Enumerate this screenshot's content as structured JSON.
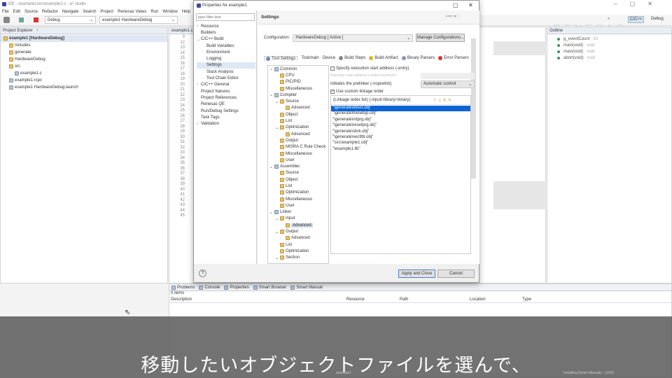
{
  "window": {
    "title": "IDE - example1/src/example1.c - e² studio",
    "menu": [
      "File",
      "Edit",
      "Source",
      "Refactor",
      "Navigate",
      "Search",
      "Project",
      "Renesas Views",
      "Run",
      "Window",
      "Help"
    ]
  },
  "toolbar": {
    "build_config": "Debug",
    "launch_config": "example1 HardwareDebug",
    "perspectives": [
      "C/C++",
      "Debug"
    ]
  },
  "project_explorer": {
    "title": "Project Explorer",
    "items": [
      {
        "label": "example1 [HardwareDebug]",
        "level": 0,
        "bold": true
      },
      {
        "label": "Includes",
        "level": 1
      },
      {
        "label": "generate",
        "level": 1
      },
      {
        "label": "HardwareDebug",
        "level": 1
      },
      {
        "label": "src",
        "level": 1
      },
      {
        "label": "example1.c",
        "level": 2
      },
      {
        "label": "example1.rcpc",
        "level": 1
      },
      {
        "label": "example1 HardwareDebug.launch",
        "level": 1
      }
    ]
  },
  "editor": {
    "tab": "example1.c",
    "line_numbers": [
      "3",
      "12",
      "13",
      "14",
      "15",
      "16",
      "17",
      "18",
      "19",
      "20",
      "21",
      "22",
      "23",
      "24",
      "25",
      "26",
      "27",
      "28",
      "29",
      "30",
      "31",
      "32",
      "33",
      "34",
      "35",
      "36",
      "37",
      "38",
      "39",
      "40",
      "41",
      "42",
      "43",
      "44",
      "45"
    ]
  },
  "outline": {
    "title": "Outline",
    "items": [
      {
        "name": "g_eventCount",
        "type": ": int"
      },
      {
        "name": "main(void)",
        "type": ": void"
      },
      {
        "name": "main(void)",
        "type": ": void"
      },
      {
        "name": "abort(void)",
        "type": ": void"
      }
    ]
  },
  "dialog": {
    "title": "Properties for example1",
    "filter_placeholder": "type filter text",
    "nav": [
      {
        "label": "Resource",
        "level": 0,
        "arrow": ">"
      },
      {
        "label": "Builders",
        "level": 0
      },
      {
        "label": "C/C++ Build",
        "level": 0,
        "arrow": "v"
      },
      {
        "label": "Build Variables",
        "level": 1
      },
      {
        "label": "Environment",
        "level": 1
      },
      {
        "label": "Logging",
        "level": 1
      },
      {
        "label": "Settings",
        "level": 1,
        "selected": true
      },
      {
        "label": "Stack Analysis",
        "level": 1
      },
      {
        "label": "Tool Chain Editor",
        "level": 1
      },
      {
        "label": "C/C++ General",
        "level": 0,
        "arrow": ">"
      },
      {
        "label": "Project Natures",
        "level": 0
      },
      {
        "label": "Project References",
        "level": 0
      },
      {
        "label": "Renesas QE",
        "level": 0
      },
      {
        "label": "Run/Debug Settings",
        "level": 0
      },
      {
        "label": "Task Tags",
        "level": 0
      },
      {
        "label": "Validation",
        "level": 0,
        "arrow": ">"
      }
    ],
    "page_title": "Settings",
    "configuration_label": "Configuration:",
    "configuration_value": "HardwareDebug  [ Active ]",
    "manage_button": "Manage Configurations...",
    "tabs": [
      "Tool Settings",
      "Toolchain",
      "Device",
      "Build Steps",
      "Build Artifact",
      "Binary Parsers",
      "Error Parsers"
    ],
    "tool_tree": [
      {
        "label": "Common",
        "level": 0,
        "arrow": "v",
        "tool": true
      },
      {
        "label": "CPU",
        "level": 1
      },
      {
        "label": "PIC/PID",
        "level": 1
      },
      {
        "label": "Miscellaneous",
        "level": 1
      },
      {
        "label": "Compiler",
        "level": 0,
        "arrow": "v",
        "tool": true
      },
      {
        "label": "Source",
        "level": 1,
        "arrow": "v"
      },
      {
        "label": "Advanced",
        "level": 2
      },
      {
        "label": "Object",
        "level": 1
      },
      {
        "label": "List",
        "level": 1
      },
      {
        "label": "Optimization",
        "level": 1,
        "arrow": "v"
      },
      {
        "label": "Advanced",
        "level": 2
      },
      {
        "label": "Output",
        "level": 1
      },
      {
        "label": "MISRA C Rule Check",
        "level": 1
      },
      {
        "label": "Miscellaneous",
        "level": 1
      },
      {
        "label": "User",
        "level": 1
      },
      {
        "label": "Assembler",
        "level": 0,
        "arrow": "v",
        "tool": true
      },
      {
        "label": "Source",
        "level": 1
      },
      {
        "label": "Object",
        "level": 1
      },
      {
        "label": "List",
        "level": 1
      },
      {
        "label": "Optimization",
        "level": 1
      },
      {
        "label": "Miscellaneous",
        "level": 1
      },
      {
        "label": "User",
        "level": 1
      },
      {
        "label": "Linker",
        "level": 0,
        "arrow": "v",
        "tool": true
      },
      {
        "label": "Input",
        "level": 1,
        "arrow": "v"
      },
      {
        "label": "Advanced",
        "level": 2,
        "selected": true
      },
      {
        "label": "Output",
        "level": 1,
        "arrow": "v"
      },
      {
        "label": "Advanced",
        "level": 2
      },
      {
        "label": "List",
        "level": 1
      },
      {
        "label": "Optimization",
        "level": 1
      },
      {
        "label": "Section",
        "level": 1,
        "arrow": "v"
      }
    ],
    "entry_checkbox": {
      "label": "Specify execution start address (-entry)",
      "checked": false
    },
    "entry_field_label": "Execution start address (-entry=<symbol>)",
    "prelinker_label": "Initiates the prelinker (-noprelink)",
    "prelinker_value": "Automatic control",
    "linkage_checkbox": {
      "label": "Use custom linkage order",
      "checked": true
    },
    "linkage_header": "(Linkage order list) (-input/-library/-binary)",
    "linkage_items": [
      "\"\\generate\\dbsct.obj\"",
      "\"\\generate\\hwsetup.obj\"",
      "\"\\generate\\intprg.obj\"",
      "\"\\generate\\resetprg.obj\"",
      "\"\\generate\\sbrk.obj\"",
      "\"\\generate\\vecttbl.obj\"",
      "\"\\src\\example1.obj\"",
      "\"\\example1.lib\""
    ],
    "linkage_selected": 0,
    "apply_close": "Apply and Close",
    "cancel": "Cancel"
  },
  "bottom": {
    "tabs": [
      "Problems",
      "Console",
      "Properties",
      "Smart Browser",
      "Smart Manual"
    ],
    "count": "0 items",
    "columns": [
      "Description",
      "Resource",
      "Path",
      "Location",
      "Type"
    ],
    "status_left": "example1",
    "status_right": "Installing Smart Manuals : (11%)"
  },
  "watermark": "RENESAS",
  "subtitle": "移動したいオブジェクトファイルを選んで、",
  "colors": {
    "selection": "#0a64d6",
    "subtitle_bg": "#5f5f5f"
  }
}
